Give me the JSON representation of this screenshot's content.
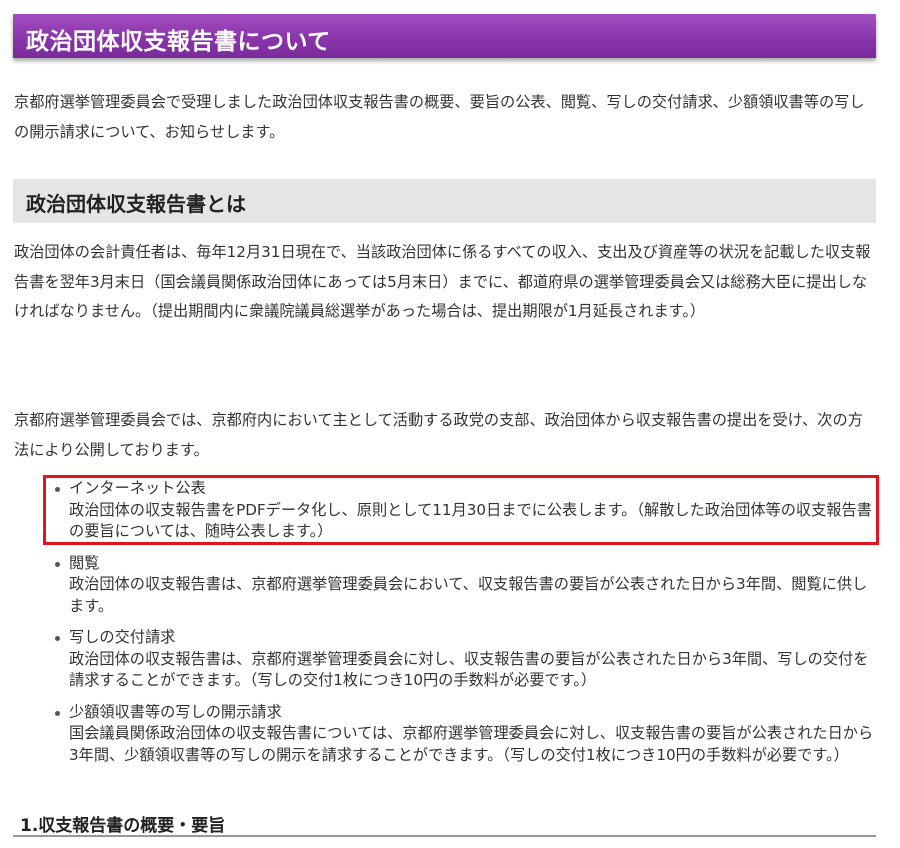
{
  "page_title": "政治団体収支報告書について",
  "intro": "京都府選挙管理委員会で受理しました政治団体収支報告書の概要、要旨の公表、閲覧、写しの交付請求、少額領収書等の写しの開示請求について、お知らせします。",
  "section1": {
    "heading": "政治団体収支報告書とは",
    "paragraph1": "政治団体の会計責任者は、毎年12月31日現在で、当該政治団体に係るすべての収入、支出及び資産等の状況を記載した収支報告書を翌年3月末日（国会議員関係政治団体にあっては5月末日）までに、都道府県の選挙管理委員会又は総務大臣に提出しなければなりません。（提出期間内に衆議院議員総選挙があった場合は、提出期限が1月延長されます。）",
    "paragraph2": "京都府選挙管理委員会では、京都府内において主として活動する政党の支部、政治団体から収支報告書の提出を受け、次の方法により公開しております。",
    "items": [
      {
        "title": "インターネット公表",
        "desc": "政治団体の収支報告書をPDFデータ化し、原則として11月30日までに公表します。（解散した政治団体等の収支報告書の要旨については、随時公表します。）"
      },
      {
        "title": "閲覧",
        "desc": "政治団体の収支報告書は、京都府選挙管理委員会において、収支報告書の要旨が公表された日から3年間、閲覧に供します。"
      },
      {
        "title": "写しの交付請求",
        "desc": "政治団体の収支報告書は、京都府選挙管理委員会に対し、収支報告書の要旨が公表された日から3年間、写しの交付を請求することができます。（写しの交付1枚につき10円の手数料が必要です。）"
      },
      {
        "title": "少額領収書等の写しの開示請求",
        "desc": "国会議員関係政治団体の収支報告書については、京都府選挙管理委員会に対し、収支報告書の要旨が公表された日から3年間、少額領収書等の写しの開示を請求することができます。（写しの交付1枚につき10円の手数料が必要です。）"
      }
    ]
  },
  "section2": {
    "heading": "1.収支報告書の概要・要旨"
  },
  "colors": {
    "title_bar": "#8a35ab",
    "section_bar": "#e5e5e5",
    "highlight_border": "#e0141e"
  }
}
